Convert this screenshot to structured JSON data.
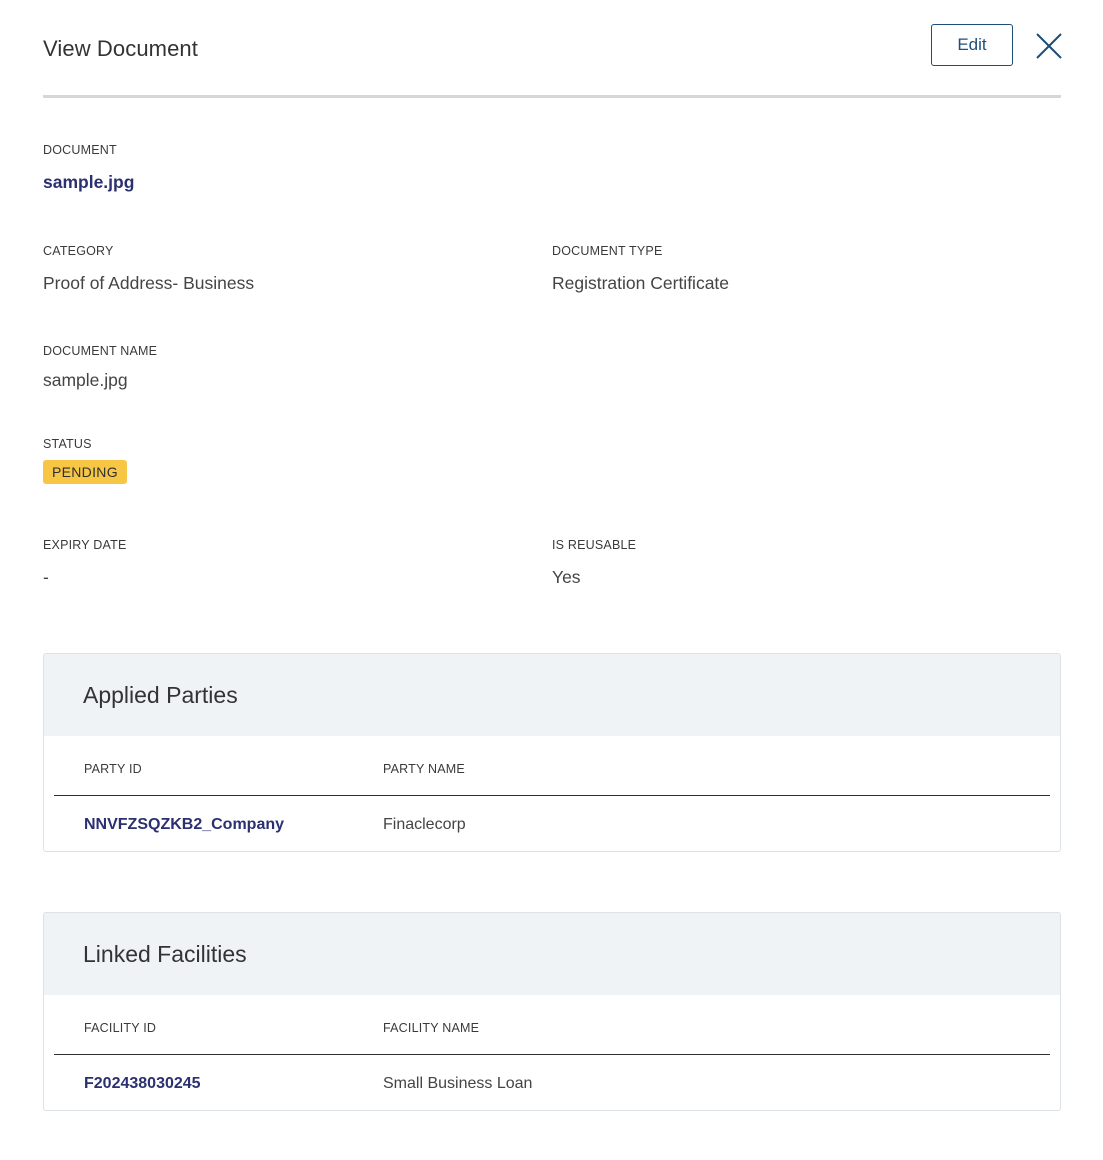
{
  "header": {
    "title": "View Document",
    "edit_label": "Edit"
  },
  "document": {
    "label": "DOCUMENT",
    "value": "sample.jpg"
  },
  "fields": {
    "category": {
      "label": "CATEGORY",
      "value": "Proof of Address- Business"
    },
    "document_type": {
      "label": "DOCUMENT TYPE",
      "value": "Registration Certificate"
    },
    "document_name": {
      "label": "DOCUMENT NAME",
      "value": "sample.jpg"
    },
    "status": {
      "label": "STATUS",
      "value": "PENDING"
    },
    "expiry_date": {
      "label": "EXPIRY DATE",
      "value": "-"
    },
    "is_reusable": {
      "label": "IS REUSABLE",
      "value": "Yes"
    }
  },
  "colors": {
    "accent": "#1f4e79",
    "link": "#2b3070",
    "status_pending": "#f6c644",
    "card_header": "#eff3f6"
  },
  "applied_parties": {
    "title": "Applied Parties",
    "columns": [
      "PARTY ID",
      "PARTY NAME"
    ],
    "rows": [
      {
        "id": "NNVFZSQZKB2_Company",
        "name": "Finaclecorp"
      }
    ]
  },
  "linked_facilities": {
    "title": "Linked Facilities",
    "columns": [
      "FACILITY ID",
      "FACILITY NAME"
    ],
    "rows": [
      {
        "id": "F202438030245",
        "name": "Small Business Loan"
      }
    ]
  },
  "icons": {
    "close": "close-icon"
  }
}
